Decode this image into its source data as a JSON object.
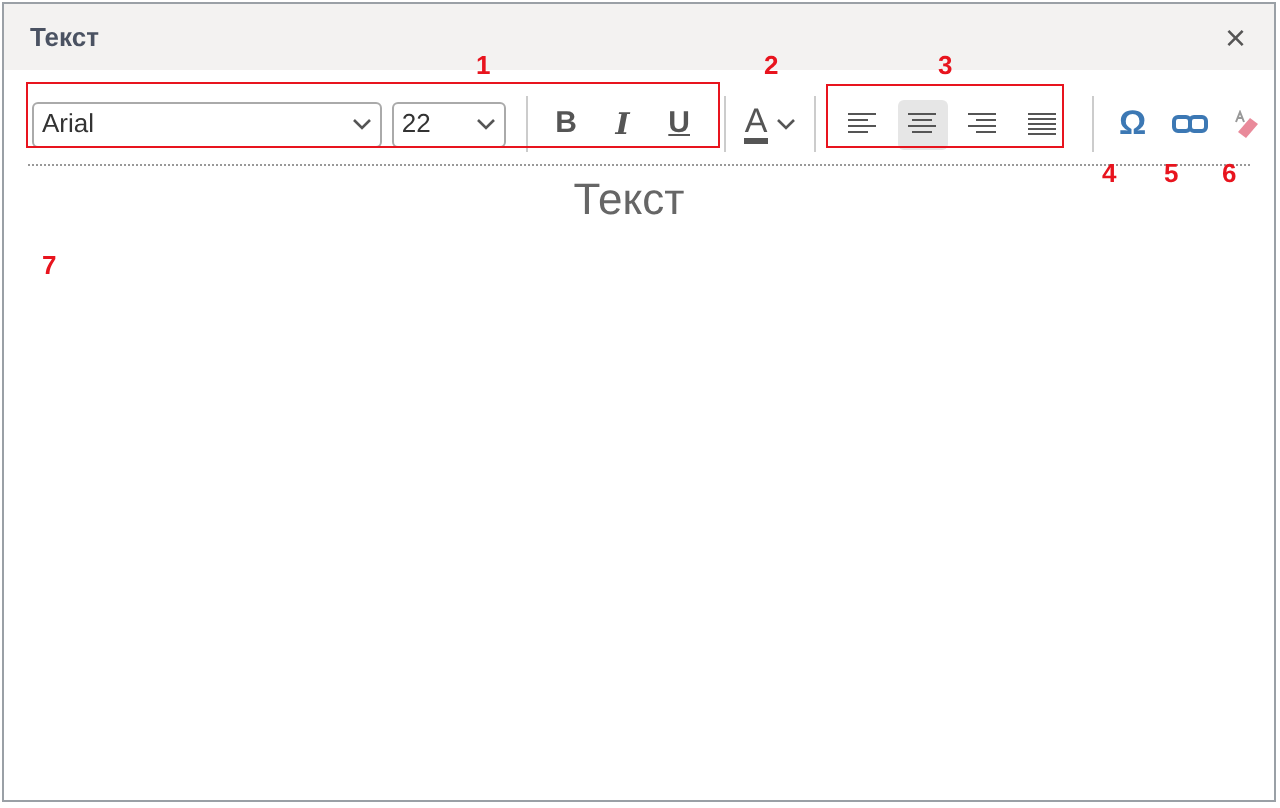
{
  "window": {
    "title": "Текст",
    "close": "×"
  },
  "toolbar": {
    "font": {
      "value": "Arial"
    },
    "size": {
      "value": "22"
    },
    "styles": [
      {
        "kind": "bold",
        "label": "B"
      },
      {
        "kind": "italic",
        "label": "I"
      },
      {
        "kind": "underline",
        "label": "U"
      }
    ],
    "font_color": {
      "label": "A"
    },
    "alignment": [
      {
        "kind": "left",
        "selected": false
      },
      {
        "kind": "center",
        "selected": true
      },
      {
        "kind": "right",
        "selected": false
      },
      {
        "kind": "justify",
        "selected": false
      }
    ],
    "special_character": {
      "label": "Ω"
    },
    "tools": [
      {
        "kind": "link"
      },
      {
        "kind": "eraser"
      }
    ]
  },
  "editor": {
    "content": "Текст"
  },
  "annotations": [
    "1",
    "2",
    "3",
    "4",
    "5",
    "6",
    "7"
  ]
}
